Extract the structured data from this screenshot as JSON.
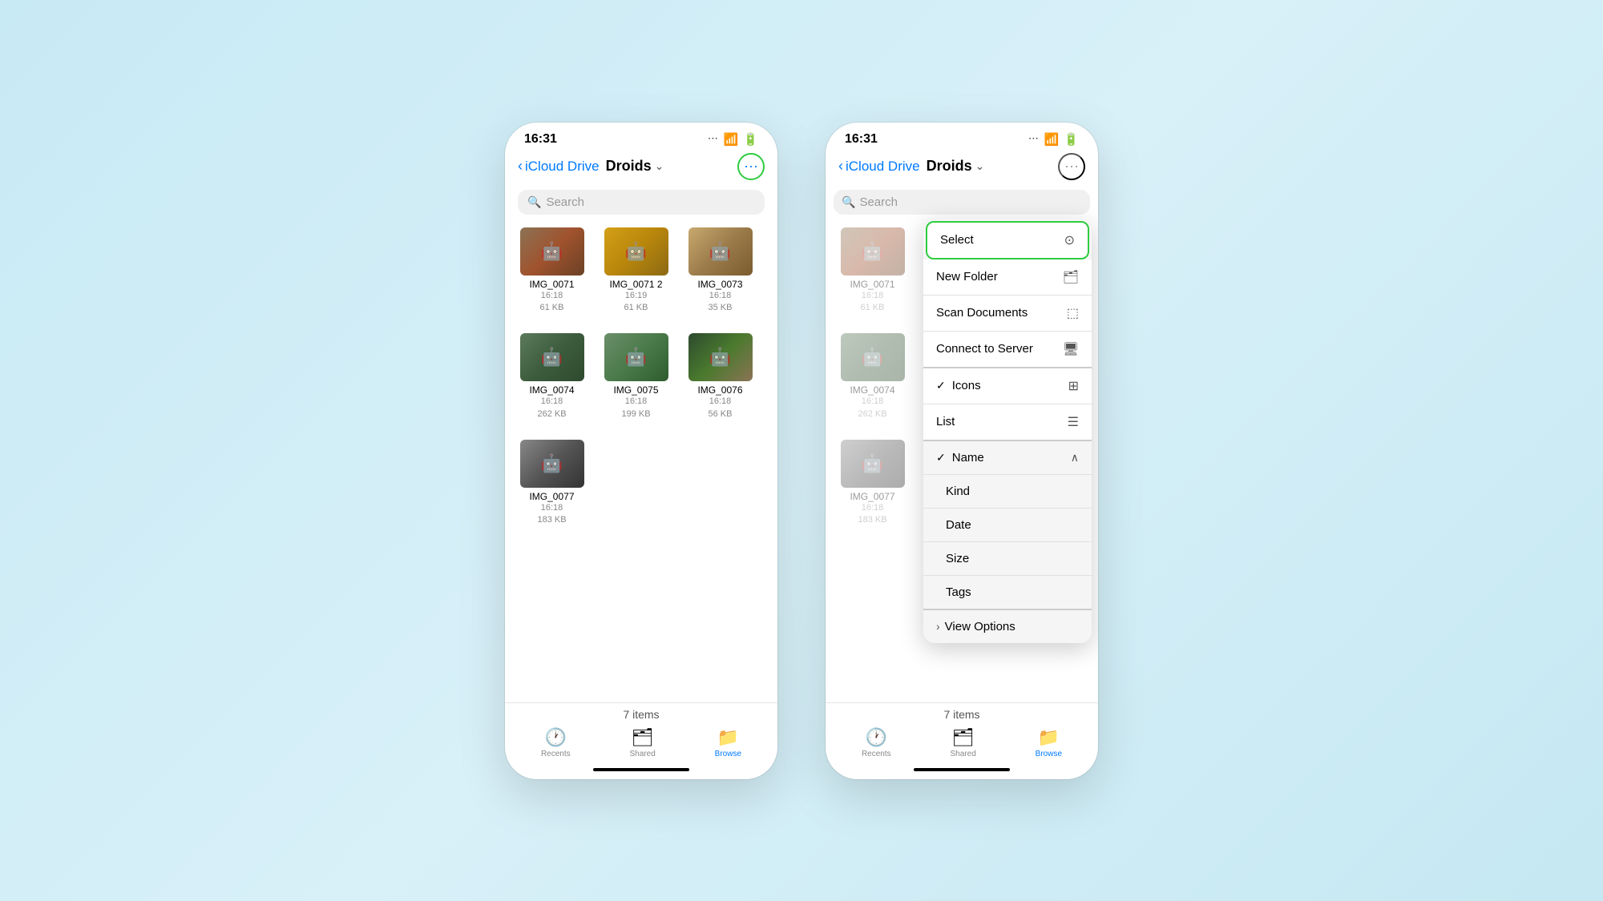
{
  "left_phone": {
    "status_time": "16:31",
    "nav_back_label": "iCloud Drive",
    "nav_title": "Droids",
    "search_placeholder": "Search",
    "files": [
      {
        "name": "IMG_0071",
        "time": "16:18",
        "size": "61 KB",
        "thumb_class": "thumb-071"
      },
      {
        "name": "IMG_0071 2",
        "time": "16:19",
        "size": "61 KB",
        "thumb_class": "thumb-0712"
      },
      {
        "name": "IMG_0073",
        "time": "16:18",
        "size": "35 KB",
        "thumb_class": "thumb-073"
      },
      {
        "name": "IMG_0074",
        "time": "16:18",
        "size": "262 KB",
        "thumb_class": "thumb-074"
      },
      {
        "name": "IMG_0075",
        "time": "16:18",
        "size": "199 KB",
        "thumb_class": "thumb-075"
      },
      {
        "name": "IMG_0076",
        "time": "16:18",
        "size": "56 KB",
        "thumb_class": "thumb-076"
      },
      {
        "name": "IMG_0077",
        "time": "16:18",
        "size": "183 KB",
        "thumb_class": "thumb-077"
      }
    ],
    "items_count": "7 items",
    "tabs": [
      {
        "label": "Recents",
        "icon": "🕐",
        "active": false
      },
      {
        "label": "Shared",
        "icon": "🗂",
        "active": false
      },
      {
        "label": "Browse",
        "icon": "📁",
        "active": true
      }
    ]
  },
  "right_phone": {
    "status_time": "16:31",
    "nav_back_label": "iCloud Drive",
    "nav_title": "Droids",
    "search_placeholder": "Search",
    "visible_files": [
      {
        "name": "IMG_0071",
        "time": "16:18",
        "size": "61 KB",
        "thumb_class": "thumb-071"
      },
      {
        "name": "IMG_0074",
        "time": "16:18",
        "size": "262 KB",
        "thumb_class": "thumb-074"
      },
      {
        "name": "IMG_0077",
        "time": "16:18",
        "size": "183 KB",
        "thumb_class": "thumb-077"
      }
    ],
    "items_count": "7 items",
    "tabs": [
      {
        "label": "Recents",
        "icon": "🕐",
        "active": false
      },
      {
        "label": "Shared",
        "icon": "🗂",
        "active": false
      },
      {
        "label": "Browse",
        "icon": "📁",
        "active": true
      }
    ],
    "dropdown": {
      "select_label": "Select",
      "new_folder_label": "New Folder",
      "scan_documents_label": "Scan Documents",
      "connect_to_server_label": "Connect to Server",
      "icons_label": "Icons",
      "list_label": "List",
      "name_label": "Name",
      "kind_label": "Kind",
      "date_label": "Date",
      "size_label": "Size",
      "tags_label": "Tags",
      "view_options_label": "View Options"
    }
  }
}
